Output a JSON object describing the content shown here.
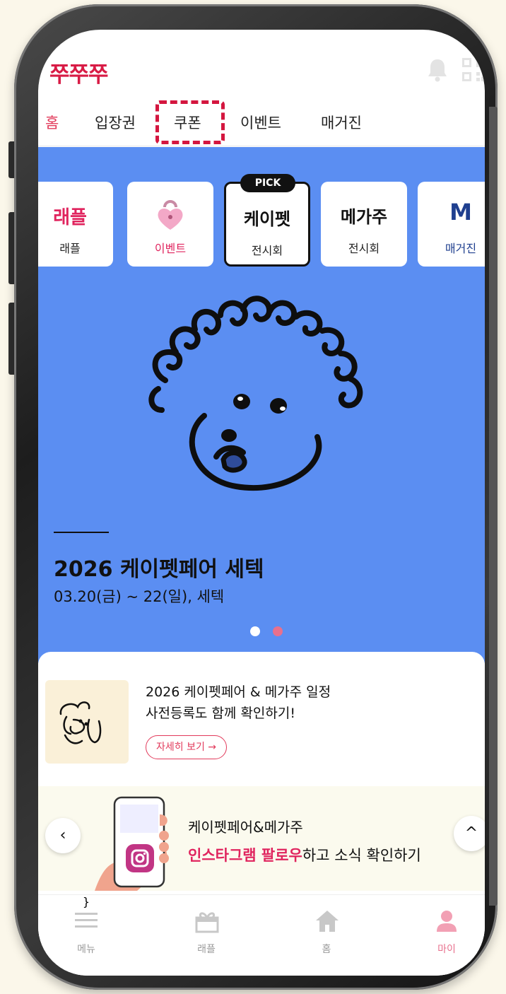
{
  "app": {
    "logo": "쭈쭈쭈"
  },
  "tabs": [
    {
      "label": "홈",
      "active": true
    },
    {
      "label": "입장권"
    },
    {
      "label": "쿠폰"
    },
    {
      "label": "이벤트"
    },
    {
      "label": "매거진"
    }
  ],
  "categories": [
    {
      "title": "래플",
      "label": "래플",
      "title_color": "#e0245e"
    },
    {
      "title": "",
      "label": "이벤트",
      "icon": "heart-lock-icon",
      "label_color": "#e0245e"
    },
    {
      "title": "케이펫",
      "label": "전시회",
      "badge": "PICK"
    },
    {
      "title": "메가주",
      "label": "전시회"
    },
    {
      "title": "M",
      "label": "매거진",
      "title_color": "#1f3f8f"
    }
  ],
  "hero": {
    "title": "2026 케이펫페어 세텍",
    "subtitle": "03.20(금) ~ 22(일), 세텍",
    "background": "#5b8ef2"
  },
  "card": {
    "title": "2026 케이펫페어 & 메가주 일정",
    "subtitle": "사전등록도 함께 확인하기!",
    "button": "자세히 보기 →"
  },
  "banner": {
    "line1": "케이펫페어&메가주",
    "line2_highlight": "인스타그램 팔로우",
    "line2_rest": "하고 소식 확인하기"
  },
  "bottom_nav": [
    {
      "label": "메뉴",
      "icon": "menu-icon"
    },
    {
      "label": "래플",
      "icon": "gift-icon"
    },
    {
      "label": "홈",
      "icon": "home-icon"
    },
    {
      "label": "마이",
      "icon": "person-icon",
      "active": true
    }
  ],
  "colors": {
    "accent": "#e0245e",
    "brand": "#d81b45",
    "hero": "#5b8ef2"
  }
}
